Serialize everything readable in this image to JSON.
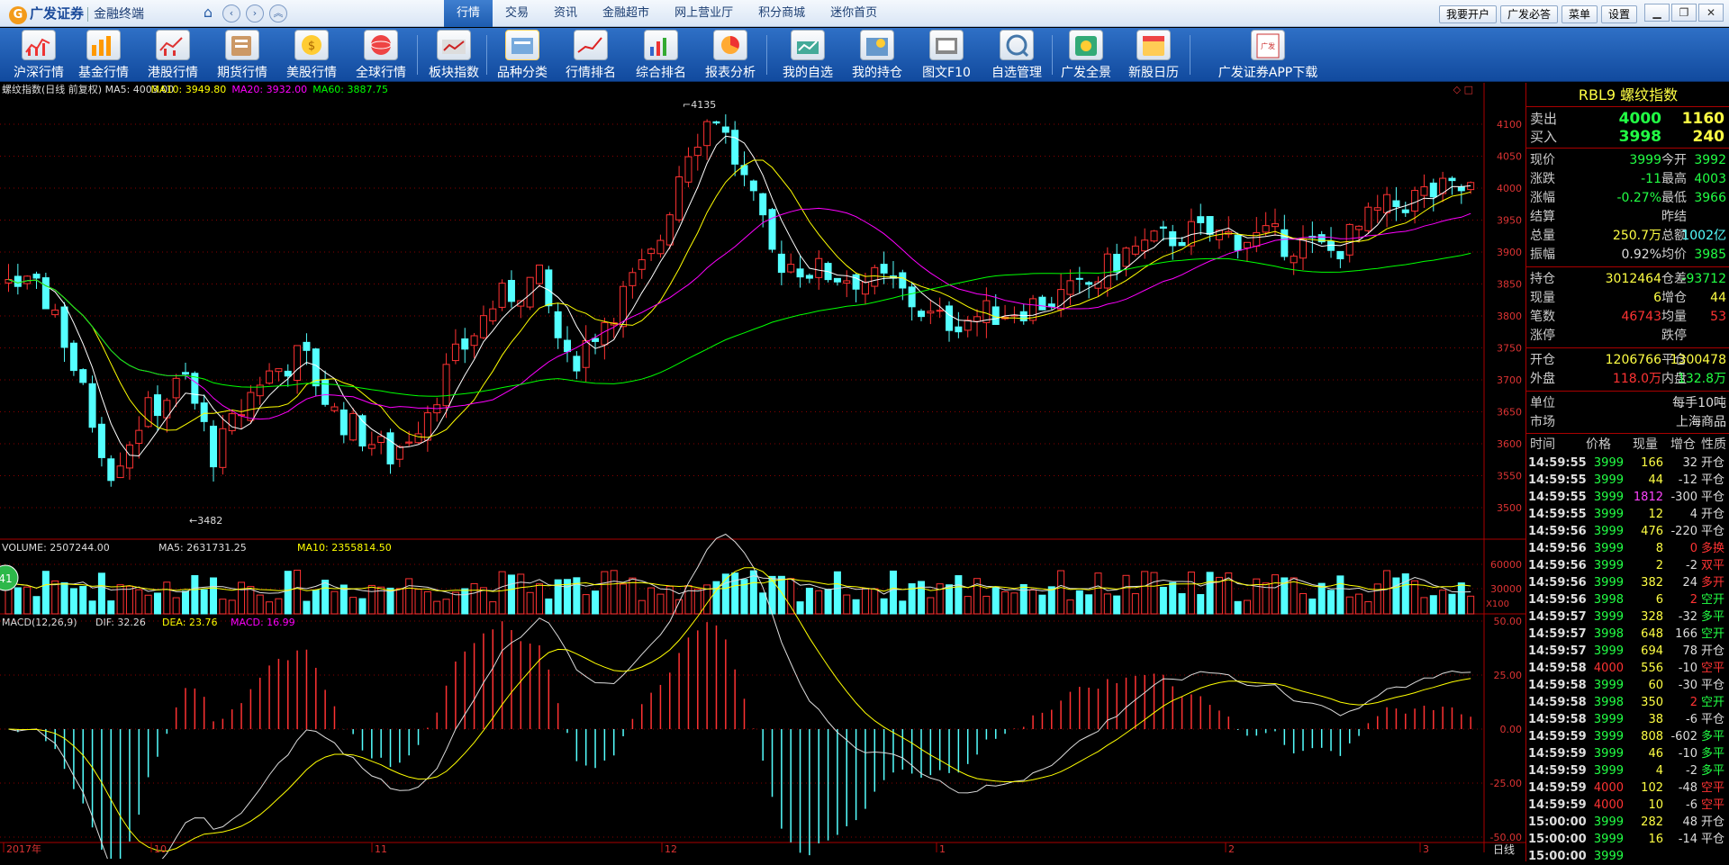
{
  "app": {
    "brand": "广发证券",
    "subtitle": "金融终端",
    "brand_icon": "G"
  },
  "topmenu": [
    "行情",
    "交易",
    "资讯",
    "金融超市",
    "网上营业厅",
    "积分商城",
    "迷你首页"
  ],
  "rightbtns": [
    "我要开户",
    "广发必答",
    "菜单",
    "设置"
  ],
  "winbtns": [
    "minimize-icon",
    "restore-icon",
    "close-icon"
  ],
  "toolbar": [
    "沪深行情",
    "基金行情",
    "港股行情",
    "期货行情",
    "美股行情",
    "全球行情",
    "板块指数",
    "品种分类",
    "行情排名",
    "综合排名",
    "报表分析",
    "我的自选",
    "我的持仓",
    "图文F10",
    "自选管理",
    "广发全景",
    "新股日历",
    "广发证券APP下载"
  ],
  "chart": {
    "title": "螺纹指数(日线 前复权)",
    "ma5": "MA5: 4003.00",
    "ma10": "MA10: 3949.80",
    "ma20": "MA20: 3932.00",
    "ma60": "MA60: 3887.75",
    "high_label": "4135",
    "low_label": "3482",
    "price_ticks": [
      "4100",
      "4050",
      "4000",
      "3950",
      "3900",
      "3850",
      "3800",
      "3750",
      "3700",
      "3650",
      "3600",
      "3550",
      "3500"
    ],
    "vol_title": "VOLUME: 2507244.00",
    "vol_ma5": "MA5: 2631731.25",
    "vol_ma10": "MA10: 2355814.50",
    "vol_ticks": [
      "60000",
      "30000"
    ],
    "vol_unit": "X100",
    "vol_badge": "41",
    "macd_title": "MACD(12,26,9)",
    "dif": "DIF: 32.26",
    "dea": "DEA: 23.76",
    "macd": "MACD: 16.99",
    "macd_ticks": [
      "50.00",
      "25.00",
      "0.00",
      "-25.00",
      "-50.00"
    ],
    "x_labels": [
      "2017年",
      "10",
      "11",
      "12",
      "1",
      "2",
      "3"
    ],
    "period": "日线",
    "colors": {
      "up": "#ff3232",
      "down": "#54ffff",
      "ma5": "#ffffff",
      "ma10": "#ffff00",
      "ma20": "#ff00ff",
      "ma60": "#00ff00"
    }
  },
  "quote": {
    "name": "RBL9 螺纹指数",
    "sell_label": "卖出",
    "sell_price": "4000",
    "sell_vol": "1160",
    "buy_label": "买入",
    "buy_price": "3998",
    "buy_vol": "240",
    "rows1": [
      [
        "现价",
        "3999",
        "今开",
        "3992"
      ],
      [
        "涨跌",
        "-11",
        "最高",
        "4003"
      ],
      [
        "涨幅",
        "-0.27%",
        "最低",
        "3966"
      ],
      [
        "结算",
        "",
        "昨结",
        ""
      ],
      [
        "总量",
        "250.7万",
        "总额",
        "1002亿"
      ],
      [
        "振幅",
        "0.92%",
        "均价",
        "3985"
      ]
    ],
    "rows2": [
      [
        "持仓",
        "3012464",
        "仓差",
        "-93712"
      ],
      [
        "现量",
        "6",
        "增仓",
        "44"
      ],
      [
        "笔数",
        "46743",
        "均量",
        "53"
      ],
      [
        "涨停",
        "",
        "跌停",
        ""
      ]
    ],
    "rows3": [
      [
        "开仓",
        "1206766",
        "平仓",
        "1300478"
      ],
      [
        "外盘",
        "118.0万",
        "内盘",
        "132.8万"
      ]
    ],
    "unit_label": "单位",
    "unit_value": "每手10吨",
    "market_label": "市场",
    "market_value": "上海商品",
    "tick_headers": [
      "时间",
      "价格",
      "现量",
      "增仓",
      "性质"
    ],
    "ticks": [
      [
        "14:59:55",
        "3999",
        "166",
        "32",
        "开仓"
      ],
      [
        "14:59:55",
        "3999",
        "44",
        "-12",
        "平仓"
      ],
      [
        "14:59:55",
        "3999",
        "1812",
        "-300",
        "平仓"
      ],
      [
        "14:59:55",
        "3999",
        "12",
        "4",
        "开仓"
      ],
      [
        "14:59:56",
        "3999",
        "476",
        "-220",
        "平仓"
      ],
      [
        "14:59:56",
        "3999",
        "8",
        "0",
        "多换"
      ],
      [
        "14:59:56",
        "3999",
        "2",
        "-2",
        "双平"
      ],
      [
        "14:59:56",
        "3999",
        "382",
        "24",
        "多开"
      ],
      [
        "14:59:56",
        "3998",
        "6",
        "2",
        "空开"
      ],
      [
        "14:59:57",
        "3999",
        "328",
        "-32",
        "多平"
      ],
      [
        "14:59:57",
        "3998",
        "648",
        "166",
        "空开"
      ],
      [
        "14:59:57",
        "3999",
        "694",
        "78",
        "开仓"
      ],
      [
        "14:59:58",
        "4000",
        "556",
        "-10",
        "空平"
      ],
      [
        "14:59:58",
        "3999",
        "60",
        "-30",
        "平仓"
      ],
      [
        "14:59:58",
        "3998",
        "350",
        "2",
        "空开"
      ],
      [
        "14:59:58",
        "3999",
        "38",
        "-6",
        "平仓"
      ],
      [
        "14:59:59",
        "3999",
        "808",
        "-602",
        "多平"
      ],
      [
        "14:59:59",
        "3999",
        "46",
        "-10",
        "多平"
      ],
      [
        "14:59:59",
        "3999",
        "4",
        "-2",
        "多平"
      ],
      [
        "14:59:59",
        "4000",
        "102",
        "-48",
        "空平"
      ],
      [
        "14:59:59",
        "4000",
        "10",
        "-6",
        "空平"
      ],
      [
        "15:00:00",
        "3999",
        "282",
        "48",
        "开仓"
      ],
      [
        "15:00:00",
        "3999",
        "16",
        "-14",
        "平仓"
      ],
      [
        "15:00:00",
        "3999",
        "",
        "",
        ""
      ]
    ]
  }
}
